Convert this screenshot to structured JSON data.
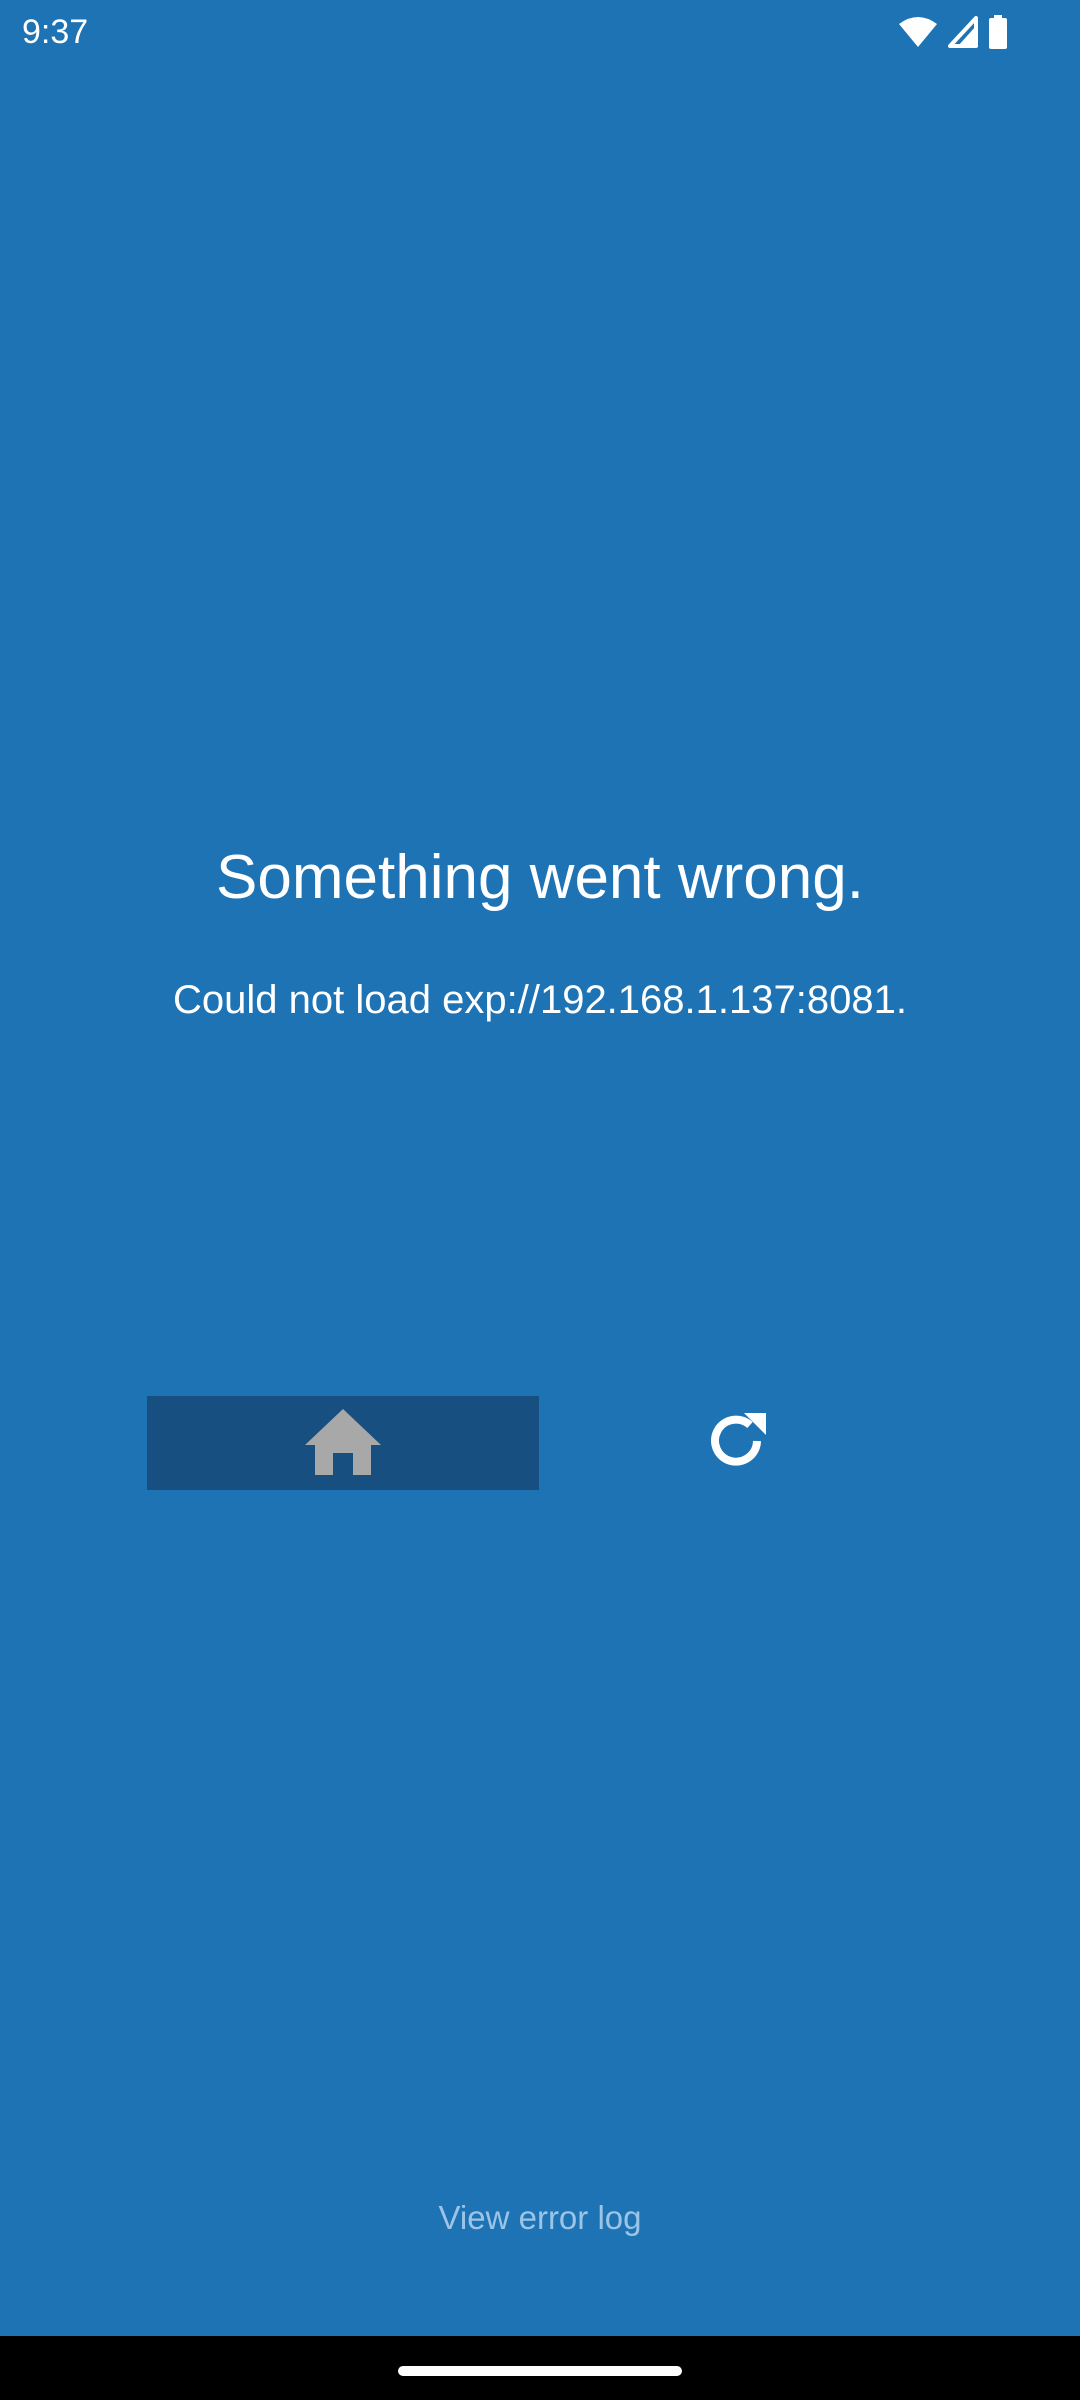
{
  "status_bar": {
    "time": "9:37",
    "icons": [
      "wifi-icon",
      "cell-signal-icon",
      "battery-icon"
    ]
  },
  "error": {
    "title": "Something went wrong.",
    "message": "Could not load exp://192.168.1.137:8081."
  },
  "actions": {
    "home_icon": "home-icon",
    "reload_icon": "reload-icon"
  },
  "footer": {
    "link_label": "View error log"
  },
  "colors": {
    "background": "#1e73b5",
    "home_button_bg": "#174f80",
    "home_icon": "#a8a8a8",
    "link_text": "#9cc4e6",
    "nav_bar": "#000000"
  }
}
